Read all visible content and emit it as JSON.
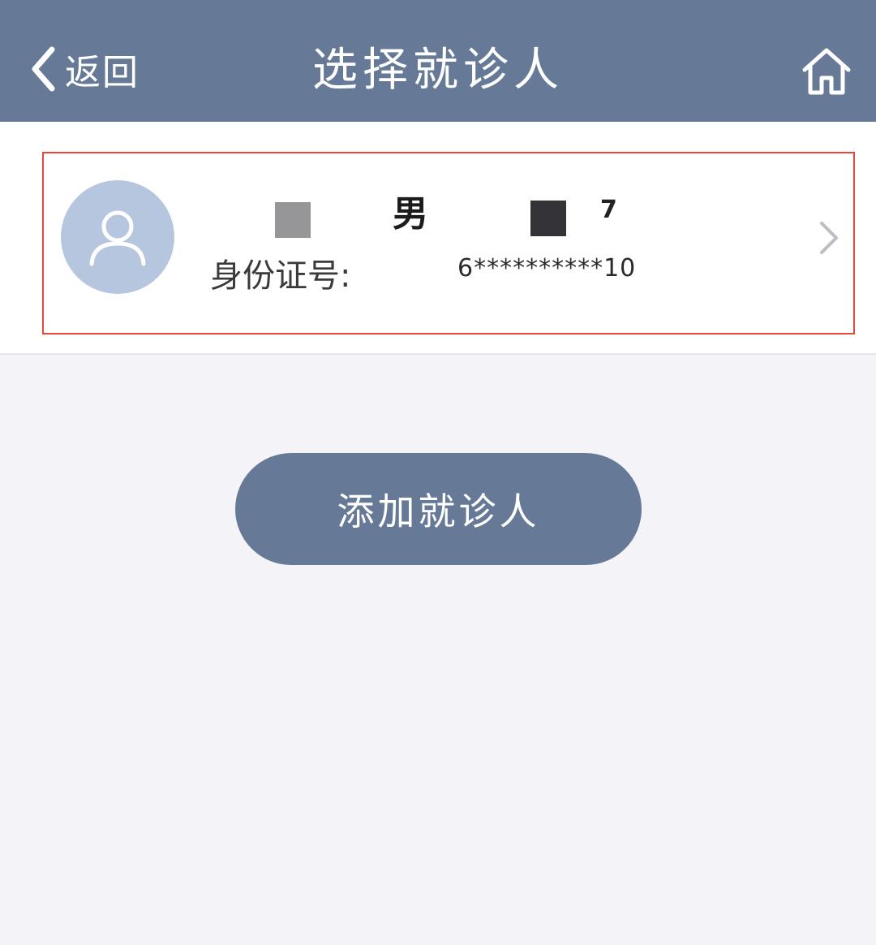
{
  "header": {
    "back_label": "返回",
    "title": "选择就诊人",
    "back_icon": "chevron-left-icon",
    "home_icon": "home-icon"
  },
  "patient": {
    "gender": "男",
    "id_label": "身份证号:",
    "id_value": "6**********10",
    "name_fragment": "7",
    "avatar_icon": "person-icon",
    "chevron_icon": "chevron-right-icon"
  },
  "actions": {
    "add_patient_label": "添加就诊人"
  },
  "colors": {
    "header_bg": "#667a97",
    "page_bg": "#f4f3f7",
    "highlight_border": "#e4483a",
    "avatar_bg": "#b6c6de"
  }
}
